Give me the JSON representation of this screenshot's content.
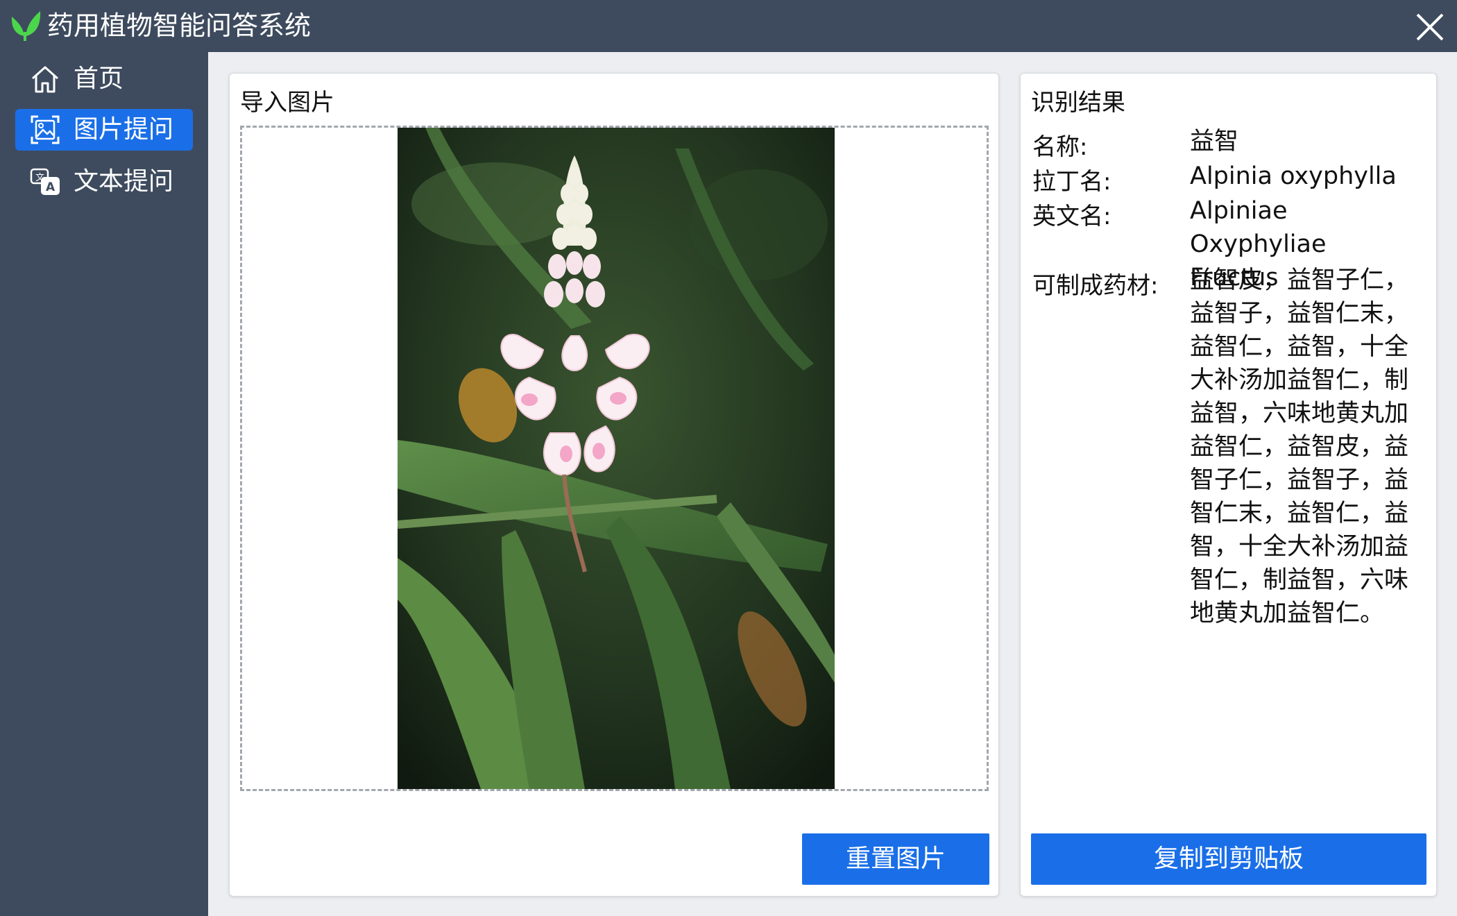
{
  "app": {
    "title": "药用植物智能问答系统",
    "colors": {
      "chrome": "#3e4b5e",
      "accent": "#1a6fe8",
      "logo": "#4cd64c"
    }
  },
  "window_controls": {
    "close_icon": "close-icon"
  },
  "sidebar": {
    "items": [
      {
        "label": "首页",
        "icon": "home-icon",
        "active": false
      },
      {
        "label": "图片提问",
        "icon": "image-search-icon",
        "active": true
      },
      {
        "label": "文本提问",
        "icon": "translate-chat-icon",
        "active": false
      }
    ]
  },
  "import_panel": {
    "title": "导入图片",
    "image": "pink-white-flower-spike-with-green-leaves",
    "reset_button": "重置图片"
  },
  "result_panel": {
    "title": "识别结果",
    "fields": {
      "name_label": "名称:",
      "name_value": "益智",
      "latin_label": "拉丁名:",
      "latin_value": "Alpinia oxyphylla",
      "english_label": "英文名:",
      "english_value": "Alpiniae Oxyphyliae Fructus",
      "herbs_label": "可制成药材:",
      "herbs_value": "益智皮，益智子仁，益智子，益智仁末，益智仁，益智，十全大补汤加益智仁，制益智，六味地黄丸加益智仁，益智皮，益智子仁，益智子，益智仁末，益智仁，益智，十全大补汤加益智仁，制益智，六味地黄丸加益智仁。"
    },
    "copy_button": "复制到剪贴板"
  }
}
